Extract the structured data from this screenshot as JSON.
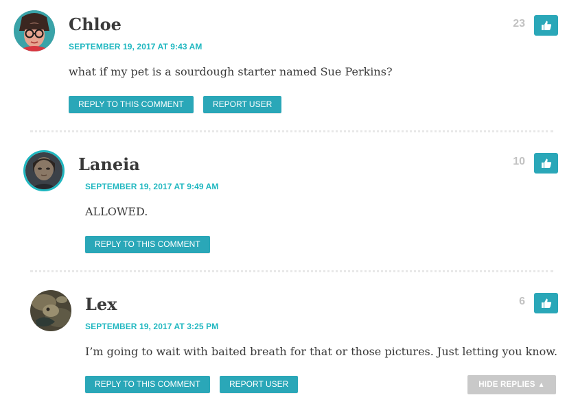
{
  "comments": [
    {
      "author": "Chloe",
      "date": "SEPTEMBER 19, 2017 AT 9:43 AM",
      "text": "what if my pet is a sourdough starter named Sue Perkins?",
      "votes": "23",
      "reply_label": "REPLY TO THIS COMMENT",
      "report_label": "REPORT USER"
    },
    {
      "author": "Laneia",
      "date": "SEPTEMBER 19, 2017 AT 9:49 AM",
      "text": "ALLOWED.",
      "votes": "10",
      "reply_label": "REPLY TO THIS COMMENT"
    },
    {
      "author": "Lex",
      "date": "SEPTEMBER 19, 2017 AT 3:25 PM",
      "text": "I’m going to wait with baited breath for that or those pictures. Just letting you know.",
      "votes": "6",
      "reply_label": "REPLY TO THIS COMMENT",
      "report_label": "REPORT USER"
    }
  ],
  "hide_replies": {
    "label": "HIDE REPLIES",
    "arrow": "▲"
  },
  "colors": {
    "accent": "#1fb7c0",
    "button": "#2aa7b8",
    "muted": "#c2c2c2",
    "hide": "#c9c9c9"
  },
  "icons": {
    "like": "thumbs-up-icon",
    "hide": "triangle-up-icon"
  }
}
